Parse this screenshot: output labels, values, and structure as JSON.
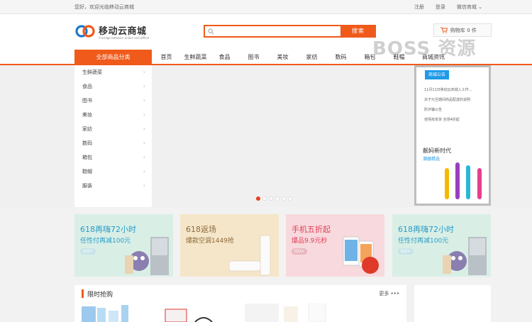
{
  "topbar": {
    "welcome": "您好，欢迎光临移动云商城",
    "register": "注册",
    "login": "登录",
    "wechat": "微信商城"
  },
  "logo": {
    "name": "移动云商城",
    "slogan": "A bridge between online and offline"
  },
  "search": {
    "placeholder": "",
    "button": "搜索"
  },
  "cart": {
    "label": "购物车 0 件"
  },
  "nav": {
    "all_categories": "全部商品分类",
    "items": [
      "首页",
      "生鲜蔬菜",
      "食品",
      "图书",
      "美妆",
      "家纺",
      "数码",
      "箱包",
      "鞋帽",
      "商城资讯"
    ]
  },
  "watermark": "BOSS 资源",
  "categories": [
    "生鲜蔬菜",
    "食品",
    "图书",
    "美妆",
    "家纺",
    "数码",
    "箱包",
    "鞋帽",
    "服装"
  ],
  "slider": {
    "count": 6,
    "active": 0
  },
  "notice": {
    "title": "商城公告",
    "items": [
      "11月11日移动云商城入工作...",
      "关于元旦期间商品配送的说明",
      "防诈骗公告",
      "佳情抢单货 全场4折起"
    ],
    "promo_title": "靓妈新时代",
    "promo_sub": "潮器精选"
  },
  "promos": [
    {
      "line1": "618再嗨72小时",
      "line2": "任性付再减100元",
      "go": "GO>",
      "bg": "#d9efe6",
      "color": "#2a9cc8"
    },
    {
      "line1": "618返场",
      "line2": "爆款空调1449抢",
      "go": "GO>",
      "bg": "#f6e6c9",
      "color": "#8a6a3a"
    },
    {
      "line1": "手机五折起",
      "line2": "爆品9.9元秒",
      "go": "GO>",
      "bg": "#f8d9dd",
      "color": "#e0405a"
    },
    {
      "line1": "618再嗨72小时",
      "line2": "任性付再减100元",
      "go": "GO>",
      "bg": "#d9efe6",
      "color": "#2a9cc8"
    }
  ],
  "flash": {
    "title": "限时抢购",
    "more": "更多"
  },
  "colors": {
    "accent": "#f05a1a",
    "notice_blue": "#1e9ae8"
  }
}
